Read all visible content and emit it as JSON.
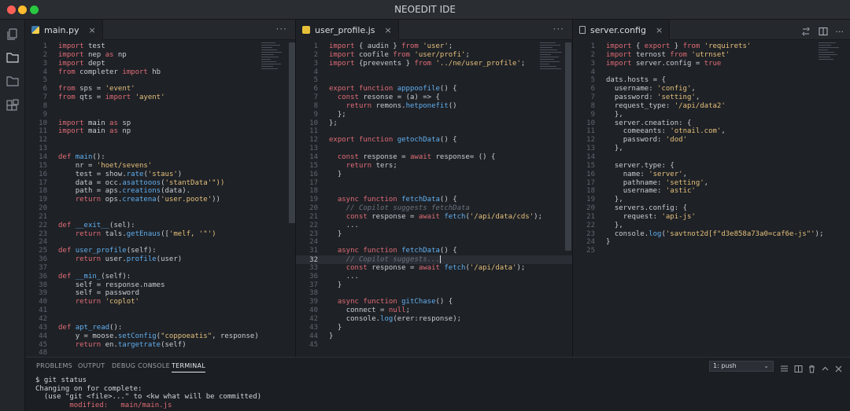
{
  "window": {
    "title": "NEOEDIT IDE"
  },
  "activity_bar": [
    "files-icon",
    "folder-icon",
    "folder-open-icon",
    "extensions-icon"
  ],
  "panes": [
    {
      "tab": {
        "label": "main.py",
        "icon": "python-file-icon",
        "close": "×"
      },
      "more": "···",
      "current_line": null,
      "lines": [
        {
          "n": "1",
          "t": "import test"
        },
        {
          "n": "2",
          "t": "import nep as np"
        },
        {
          "n": "3",
          "t": "import dept"
        },
        {
          "n": "4",
          "t": "from completer import hb"
        },
        {
          "n": "5",
          "t": ""
        },
        {
          "n": "6",
          "t": "from sps = 'event'"
        },
        {
          "n": "7",
          "t": "from qts = import 'ayent'"
        },
        {
          "n": "8",
          "t": ""
        },
        {
          "n": "9",
          "t": ""
        },
        {
          "n": "10",
          "t": "import main as sp"
        },
        {
          "n": "11",
          "t": "import main as np"
        },
        {
          "n": "12",
          "t": ""
        },
        {
          "n": "13",
          "t": ""
        },
        {
          "n": "14",
          "t": "def main():"
        },
        {
          "n": "15",
          "t": "    nr = 'hoet/sevens'"
        },
        {
          "n": "16",
          "t": "    test = show.rate('staus')"
        },
        {
          "n": "17",
          "t": "    data = occ.asattooos('stantData'\"))"
        },
        {
          "n": "18",
          "t": "    path = aps.creations(data)."
        },
        {
          "n": "19",
          "t": "    return ops.createna('user.poote'))"
        },
        {
          "n": "20",
          "t": ""
        },
        {
          "n": "21",
          "t": ""
        },
        {
          "n": "22",
          "t": "def __exit__(sel):"
        },
        {
          "n": "23",
          "t": "    return tals.getEnaus(['melf, '\"')"
        },
        {
          "n": "24",
          "t": ""
        },
        {
          "n": "25",
          "t": "def user_profile(self):"
        },
        {
          "n": "36",
          "t": "    return user.profile(user)"
        },
        {
          "n": "37",
          "t": ""
        },
        {
          "n": "36",
          "t": "def __min_(self):"
        },
        {
          "n": "38",
          "t": "    self = response.names"
        },
        {
          "n": "39",
          "t": "    self = password"
        },
        {
          "n": "40",
          "t": "    return 'coplot'"
        },
        {
          "n": "41",
          "t": ""
        },
        {
          "n": "42",
          "t": ""
        },
        {
          "n": "43",
          "t": "def apt_read():"
        },
        {
          "n": "44",
          "t": "    y = moose.setConfig(\"coppoeatis\", response)"
        },
        {
          "n": "45",
          "t": "    return en.targetrate(self)"
        },
        {
          "n": "48",
          "t": ""
        }
      ]
    },
    {
      "tab": {
        "label": "user_profile.js",
        "icon": "javascript-file-icon",
        "close": "×"
      },
      "more": "···",
      "current_line": "32",
      "lines": [
        {
          "n": "1",
          "t": "import { audin } from 'user';"
        },
        {
          "n": "2",
          "t": "import coofile from 'user/profi';"
        },
        {
          "n": "3",
          "t": "import {preevents } from '../ne/user_profile';"
        },
        {
          "n": "4",
          "t": ""
        },
        {
          "n": "5",
          "t": ""
        },
        {
          "n": "6",
          "t": "export function apppoofile() {"
        },
        {
          "n": "7",
          "t": "  const resonse = (a) => {"
        },
        {
          "n": "8",
          "t": "    return remons.hetponefit()"
        },
        {
          "n": "9",
          "t": "  };"
        },
        {
          "n": "10",
          "t": "};"
        },
        {
          "n": "11",
          "t": ""
        },
        {
          "n": "12",
          "t": "export function getochData() {"
        },
        {
          "n": "13",
          "t": ""
        },
        {
          "n": "14",
          "t": "  const response = await response= () {"
        },
        {
          "n": "15",
          "t": "    return ters;"
        },
        {
          "n": "16",
          "t": "  }"
        },
        {
          "n": "17",
          "t": ""
        },
        {
          "n": "18",
          "t": ""
        },
        {
          "n": "19",
          "t": "  async function fetchData() {"
        },
        {
          "n": "20",
          "t": "    // Copilot suggests fetchData"
        },
        {
          "n": "21",
          "t": "    const response = await fetch('/api/data/cds');"
        },
        {
          "n": "22",
          "t": "    ..."
        },
        {
          "n": "23",
          "t": "  }"
        },
        {
          "n": "24",
          "t": ""
        },
        {
          "n": "31",
          "t": "  async function fetchData() {"
        },
        {
          "n": "32",
          "t": "    // Copilot suggests..."
        },
        {
          "n": "33",
          "t": "    const response = await fetch('/api/data');"
        },
        {
          "n": "36",
          "t": "    ..."
        },
        {
          "n": "37",
          "t": "  }"
        },
        {
          "n": "38",
          "t": ""
        },
        {
          "n": "39",
          "t": "  async function gitChase() {"
        },
        {
          "n": "40",
          "t": "    connect = null;"
        },
        {
          "n": "42",
          "t": "    console.log(erer:response);"
        },
        {
          "n": "43",
          "t": "  }"
        },
        {
          "n": "44",
          "t": "}"
        },
        {
          "n": "45",
          "t": ""
        }
      ]
    },
    {
      "tab": {
        "label": "server.config",
        "icon": "config-file-icon",
        "close": "×"
      },
      "more": "",
      "current_line": null,
      "lines": [
        {
          "n": "1",
          "t": "import { export } from 'requirets'"
        },
        {
          "n": "2",
          "t": "import ternost from 'utrnset'"
        },
        {
          "n": "3",
          "t": "import server.config = true"
        },
        {
          "n": "4",
          "t": ""
        },
        {
          "n": "5",
          "t": "dats.hosts = {"
        },
        {
          "n": "6",
          "t": "  username: 'config',"
        },
        {
          "n": "7",
          "t": "  password: 'setting',"
        },
        {
          "n": "8",
          "t": "  request_type: '/api/data2'"
        },
        {
          "n": "9",
          "t": "  },"
        },
        {
          "n": "10",
          "t": "  server.cneation: {"
        },
        {
          "n": "11",
          "t": "    comeeants: 'otnail.com',"
        },
        {
          "n": "12",
          "t": "    password: 'dod'"
        },
        {
          "n": "13",
          "t": "  },"
        },
        {
          "n": "14",
          "t": ""
        },
        {
          "n": "15",
          "t": "  server.type: {"
        },
        {
          "n": "16",
          "t": "    name: 'server',"
        },
        {
          "n": "17",
          "t": "    pathname: 'setting',"
        },
        {
          "n": "18",
          "t": "    username: 'astic'"
        },
        {
          "n": "19",
          "t": "  },"
        },
        {
          "n": "20",
          "t": "  servers.config: {"
        },
        {
          "n": "21",
          "t": "    request: 'api-js'"
        },
        {
          "n": "22",
          "t": "  },"
        },
        {
          "n": "23",
          "t": "  console.log('savtnot2d[f\"d3e858a73a0=caf6e-js\"');"
        },
        {
          "n": "24",
          "t": "}"
        },
        {
          "n": "25",
          "t": ""
        }
      ]
    }
  ],
  "panel": {
    "tabs": [
      "PROBLEMS",
      "OUTPUT",
      "DEBUG CONSOLE",
      "TERMINAL"
    ],
    "active_tab": "TERMINAL",
    "shell_select": "1: push",
    "terminal_lines": [
      {
        "t": "$ git status",
        "kind": "normal"
      },
      {
        "t": "Changing on for complete:",
        "kind": "normal"
      },
      {
        "t": "  (use \"git <file>...\" to <kw what will be committed)",
        "kind": "normal"
      },
      {
        "t": "        modified:   main/main.js",
        "kind": "modified"
      }
    ]
  },
  "colors": {
    "keyword": "#e06c75",
    "function": "#61afef",
    "string": "#e5c07b",
    "comment": "#6b737d",
    "background": "#1e2126"
  }
}
